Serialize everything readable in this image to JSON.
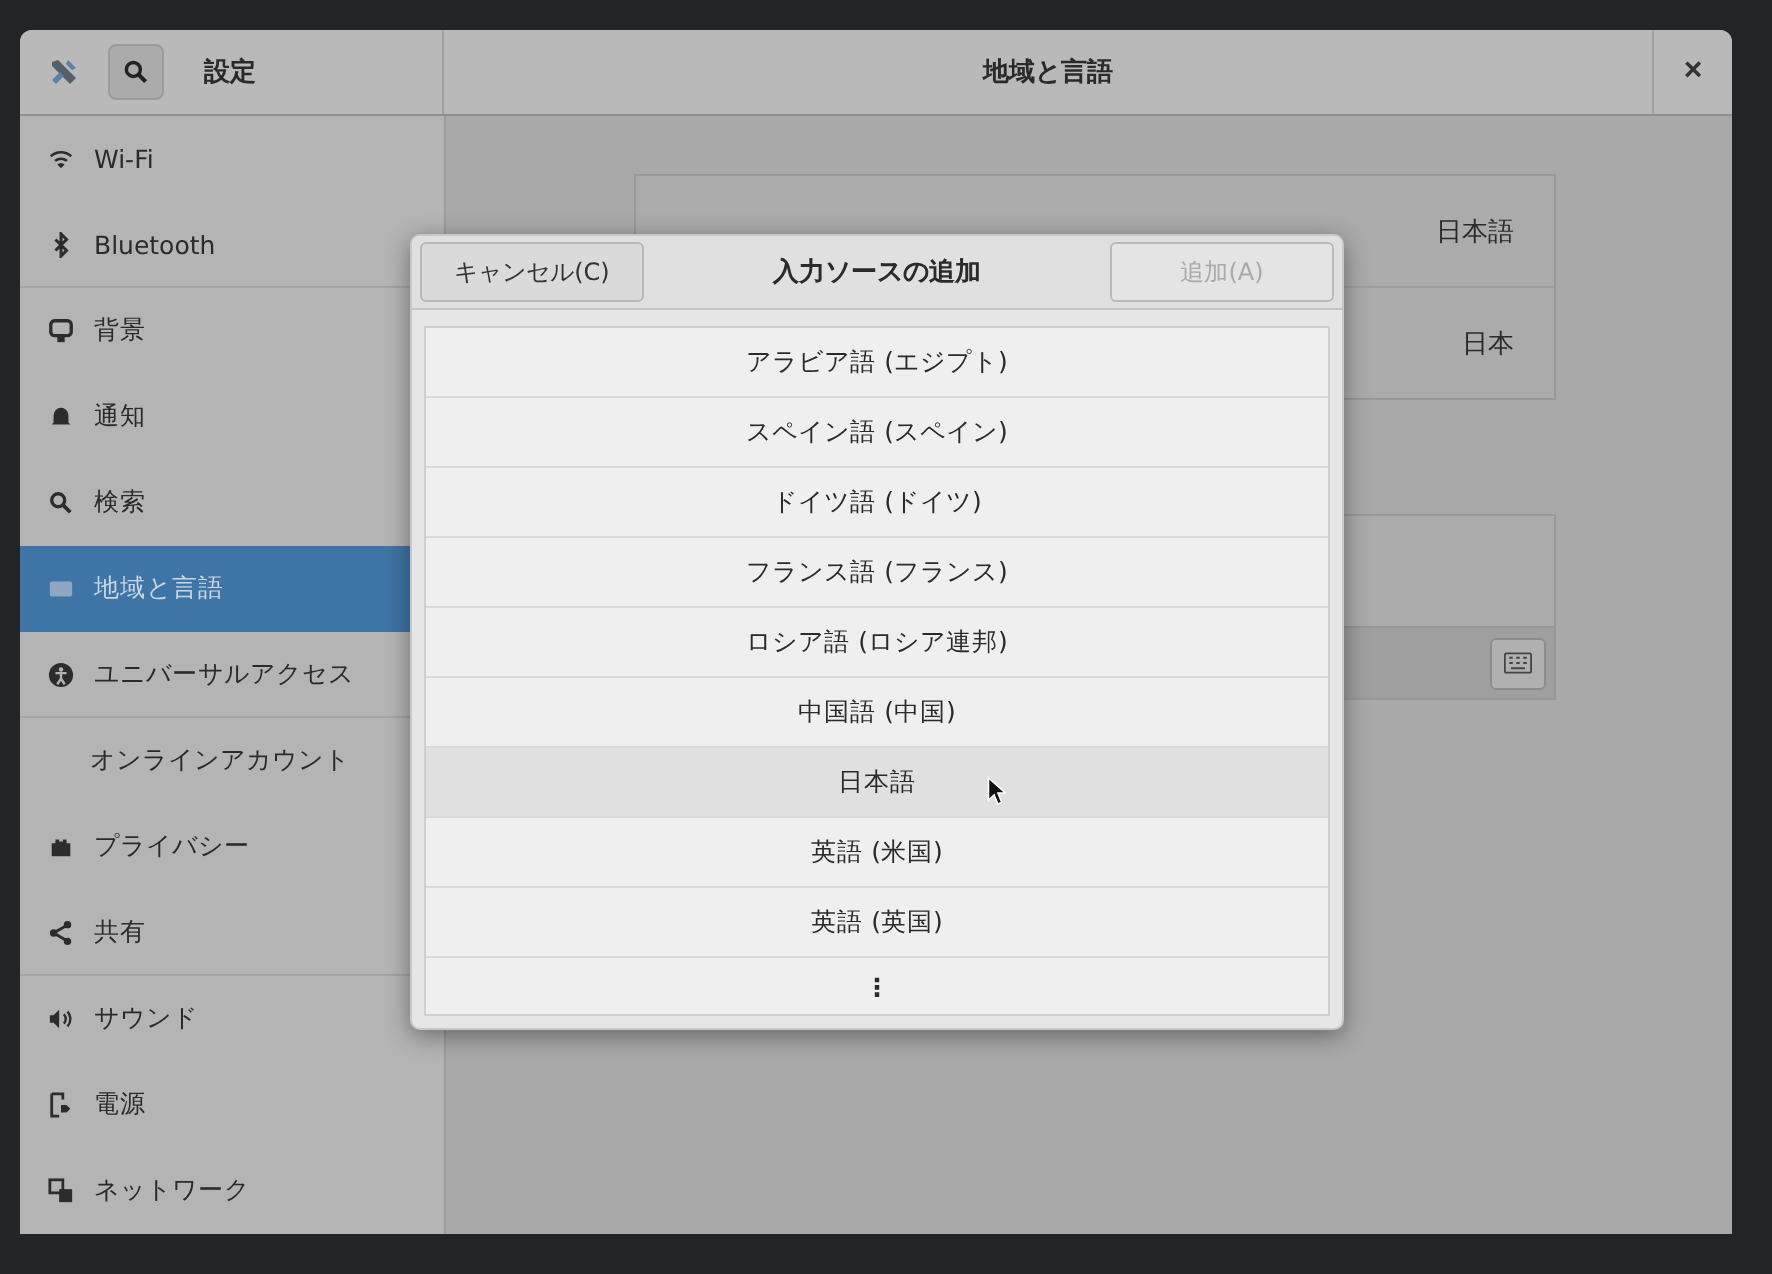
{
  "header": {
    "title": "設定",
    "window_title": "地域と言語",
    "close": "×"
  },
  "sidebar": {
    "items": [
      {
        "label": "Wi-Fi",
        "selected": false
      },
      {
        "label": "Bluetooth",
        "selected": false
      },
      {
        "label": "背景",
        "selected": false
      },
      {
        "label": "通知",
        "selected": false
      },
      {
        "label": "検索",
        "selected": false
      },
      {
        "label": "地域と言語",
        "selected": true
      },
      {
        "label": "ユニバーサルアクセス",
        "selected": false
      },
      {
        "label": "オンラインアカウント",
        "selected": false
      },
      {
        "label": "プライバシー",
        "selected": false
      },
      {
        "label": "共有",
        "selected": false
      },
      {
        "label": "サウンド",
        "selected": false
      },
      {
        "label": "電源",
        "selected": false
      },
      {
        "label": "ネットワーク",
        "selected": false
      }
    ]
  },
  "content": {
    "rows": [
      {
        "value": "日本語"
      },
      {
        "value": "日本"
      }
    ]
  },
  "dialog": {
    "title": "入力ソースの追加",
    "cancel": "キャンセル(C)",
    "add": {
      "label": "追加(A)",
      "disabled": true
    },
    "items": [
      {
        "kind": "language",
        "label": "アラビア語 (エジプト)",
        "selected": false
      },
      {
        "kind": "language",
        "label": "スペイン語 (スペイン)",
        "selected": false
      },
      {
        "kind": "language",
        "label": "ドイツ語 (ドイツ)",
        "selected": false
      },
      {
        "kind": "language",
        "label": "フランス語 (フランス)",
        "selected": false
      },
      {
        "kind": "language",
        "label": "ロシア語 (ロシア連邦)",
        "selected": false
      },
      {
        "kind": "language",
        "label": "中国語 (中国)",
        "selected": false
      },
      {
        "kind": "language",
        "label": "日本語",
        "selected": true
      },
      {
        "kind": "language",
        "label": "英語 (米国)",
        "selected": false
      },
      {
        "kind": "language",
        "label": "英語 (英国)",
        "selected": false
      },
      {
        "kind": "more",
        "label": "⋮",
        "selected": false
      }
    ]
  }
}
